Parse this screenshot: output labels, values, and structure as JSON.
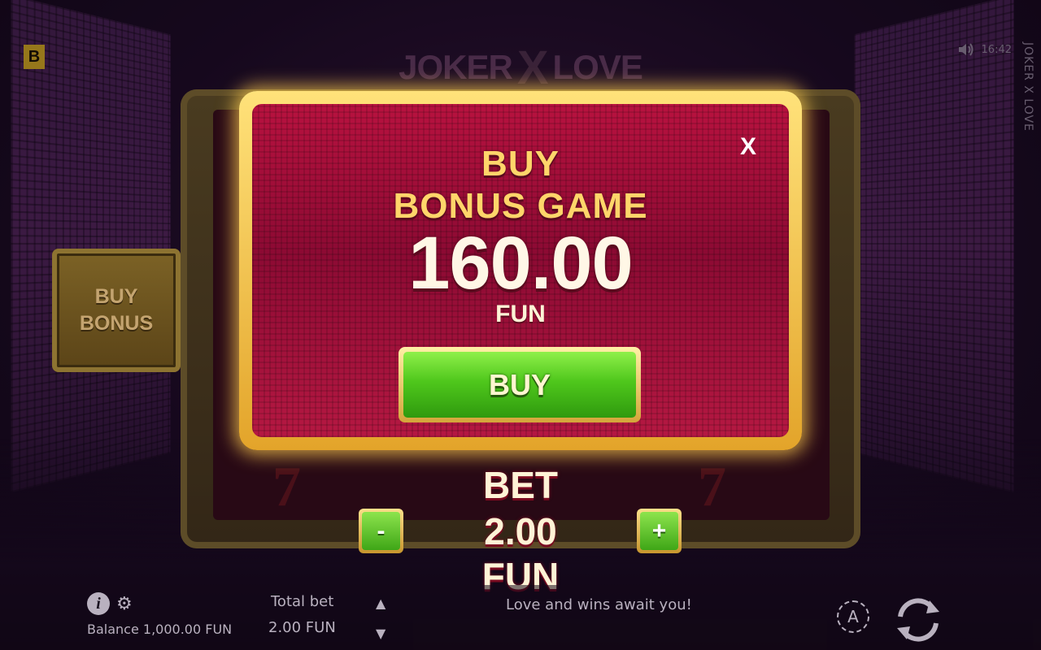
{
  "brand": {
    "badge": "B"
  },
  "game": {
    "logo_left": "JOKER",
    "logo_x": "X",
    "logo_right": "LOVE",
    "vertical_title": "JOKER X LOVE",
    "clock": "16:42",
    "sound_icon": "speaker-icon"
  },
  "side_button": {
    "line1": "BUY",
    "line2": "BONUS"
  },
  "modal": {
    "close_label": "X",
    "title_line1": "BUY",
    "title_line2": "BONUS GAME",
    "price": "160.00",
    "currency": "FUN",
    "buy_label": "BUY"
  },
  "bet": {
    "label": "BET",
    "value": "2.00",
    "currency": "FUN",
    "minus_label": "-",
    "plus_label": "+"
  },
  "bottom": {
    "balance": "Balance 1,000.00 FUN",
    "total_bet_label": "Total bet",
    "total_bet_value": "2.00 FUN",
    "message": "Love and wins await you!",
    "auto_label": "A",
    "up_arrow": "▲",
    "down_arrow": "▼"
  },
  "reel_symbol": "7",
  "colors": {
    "gold": "#ffd56a",
    "green": "#4fc71c",
    "panel_red": "#b8123f"
  }
}
